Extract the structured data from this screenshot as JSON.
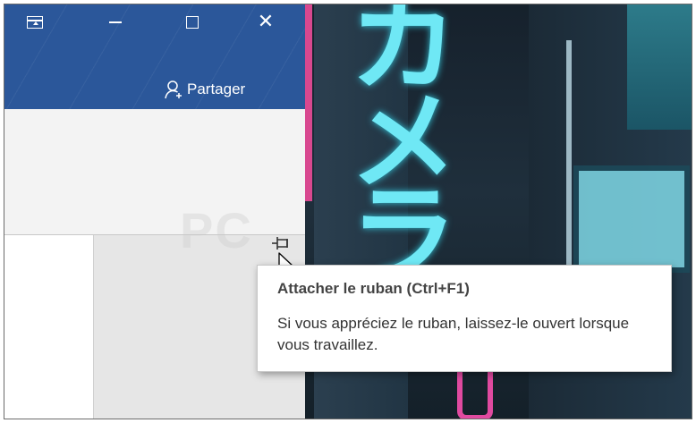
{
  "window": {
    "share_label": "Partager",
    "controls": [
      "ribbon-display-options",
      "minimize",
      "maximize",
      "close"
    ]
  },
  "watermark": "PC",
  "tooltip": {
    "title": "Attacher le ruban (Ctrl+F1)",
    "body": "Si vous appréciez le ruban, laissez-le ouvert lorsque vous travaillez."
  },
  "icons": [
    "ribbon-display-icon",
    "minimize-icon",
    "maximize-icon",
    "close-icon",
    "add-person-icon",
    "pin-icon",
    "mouse-cursor-icon"
  ],
  "colors": {
    "titlebar": "#2b579a",
    "ribbon": "#f3f3f3",
    "workspace": "#e6e6e6",
    "tooltip_bg": "#ffffff"
  }
}
